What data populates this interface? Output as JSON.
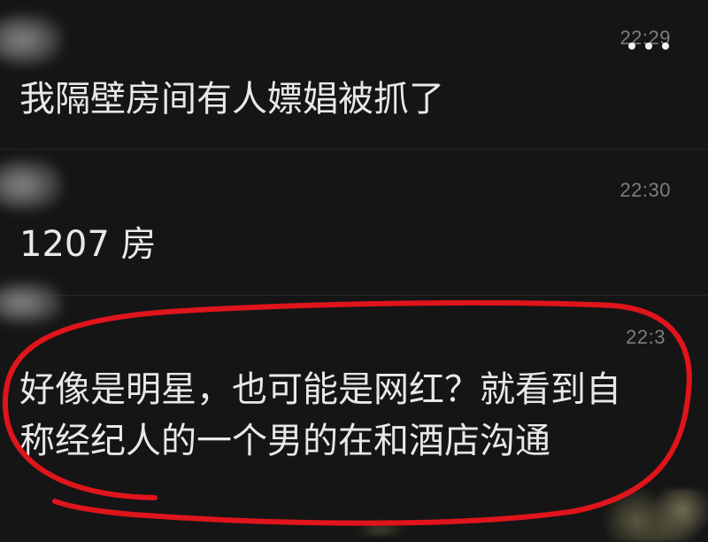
{
  "colors": {
    "background": "#151515",
    "message_text": "#e8e8e8",
    "timestamp": "#7d7d7d",
    "highlight_circle": "#e0141b"
  },
  "messages": [
    {
      "time": "22:29",
      "lines": [
        "我隔壁房间有人嫖娼被抓了"
      ]
    },
    {
      "time": "22:30",
      "lines": [
        "1207 房"
      ]
    },
    {
      "time": "22:3",
      "lines": [
        "好像是明星，也可能是网红？就看到自",
        "称经纪人的一个男的在和酒店沟通"
      ]
    }
  ]
}
